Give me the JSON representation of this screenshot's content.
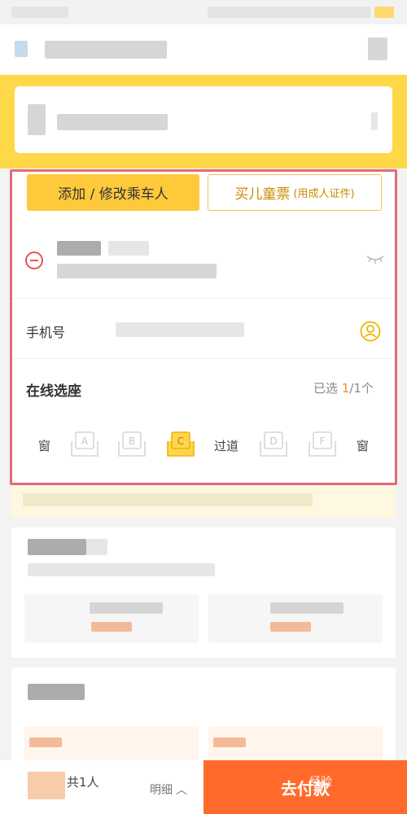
{
  "buttons": {
    "add_passenger": "添加 / 修改乘车人",
    "child_ticket_main": "买儿童票",
    "child_ticket_sub": "(用成人证件)"
  },
  "contact": {
    "phone_label": "手机号"
  },
  "seat_selection": {
    "title": "在线选座",
    "selected_prefix": "已选 ",
    "selected_count": "1",
    "selected_suffix": "/1个",
    "window_label": "窗",
    "aisle_label": "过道",
    "seats": [
      {
        "letter": "A",
        "selected": false
      },
      {
        "letter": "B",
        "selected": false
      },
      {
        "letter": "C",
        "selected": true
      },
      {
        "letter": "D",
        "selected": false
      },
      {
        "letter": "F",
        "selected": false
      }
    ]
  },
  "footer": {
    "total": "共1人",
    "detail": "明细",
    "pay": "去付款"
  },
  "watermark": "经验",
  "colors": {
    "accent_yellow": "#ffc93c",
    "pay_orange": "#ff6a2b",
    "highlight_border": "#e36a7c",
    "remove_red": "#e95454"
  }
}
